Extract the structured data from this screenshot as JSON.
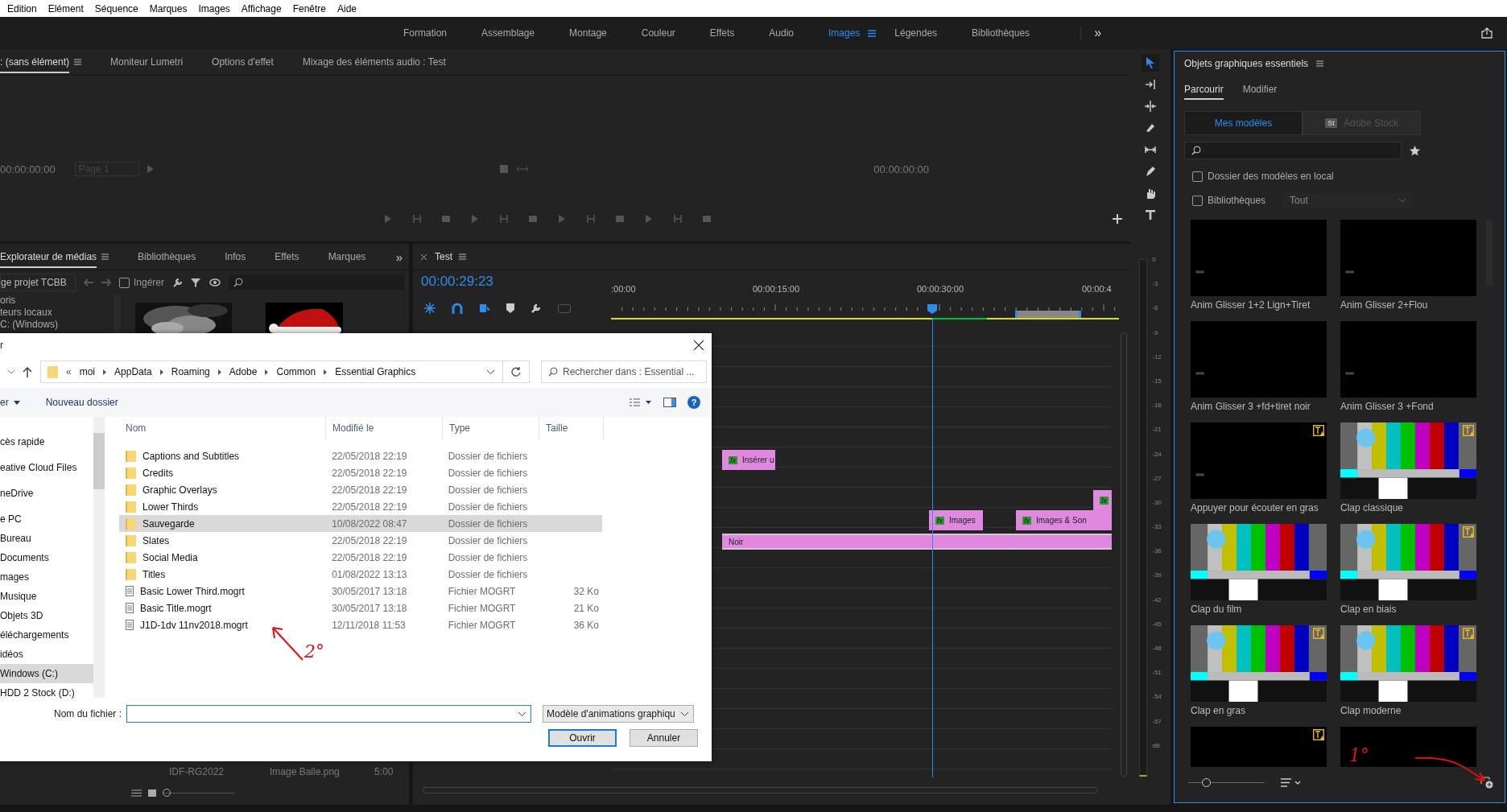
{
  "menu": [
    "Edition",
    "Elément",
    "Séquence",
    "Marques",
    "Images",
    "Affichage",
    "Fenêtre",
    "Aide"
  ],
  "workspaces": [
    {
      "label": "Formation",
      "selected": false
    },
    {
      "label": "Assemblage",
      "selected": false
    },
    {
      "label": "Montage",
      "selected": false
    },
    {
      "label": "Couleur",
      "selected": false
    },
    {
      "label": "Effets",
      "selected": false
    },
    {
      "label": "Audio",
      "selected": false
    },
    {
      "label": "Images",
      "selected": true
    },
    {
      "label": "Légendes",
      "selected": false
    },
    {
      "label": "Bibliothèques",
      "selected": false
    }
  ],
  "workspace_overflow": "»",
  "monitor": {
    "tabs": [
      {
        "label": ": (sans élément)",
        "selected": true
      },
      {
        "label": "Moniteur Lumetri",
        "selected": false
      },
      {
        "label": "Options d'effet",
        "selected": false
      },
      {
        "label": "Mixage des éléments audio : Test",
        "selected": false
      }
    ],
    "timecode_left": "00:00:00:00",
    "page": "Page 1",
    "timecode_right": "00:00:00:00"
  },
  "tools": [
    {
      "selected": true
    },
    {
      "selected": false
    },
    {
      "selected": false
    },
    {
      "selected": false
    },
    {
      "selected": false
    },
    {
      "selected": false
    },
    {
      "selected": false
    },
    {
      "selected": false
    }
  ],
  "media_browser": {
    "tabs": [
      {
        "label": "Explorateur de médias",
        "selected": true
      },
      {
        "label": "Bibliothèques",
        "selected": false
      },
      {
        "label": "Infos",
        "selected": false
      },
      {
        "label": "Effets",
        "selected": false
      },
      {
        "label": "Marques",
        "selected": false
      }
    ],
    "overflow": "»",
    "location": "ge  projet TCBB",
    "ingest": {
      "label": "Ingérer",
      "checked": false
    },
    "tree": [
      "oris",
      "teurs locaux",
      "C: (Windows)"
    ],
    "list_row": [
      "IDF-RG2022",
      "Image Balle.png",
      "5:00"
    ],
    "zoom": {
      "level": 0.0
    }
  },
  "timeline": {
    "tab": "Test",
    "timecode": "00:00:29:23",
    "ruler": [
      ":00:00",
      "00:00:15:00",
      "00:00:30:00",
      "00:00:4"
    ],
    "clips": [
      {
        "label": "Insérer u",
        "badge": "fx"
      },
      {
        "badge": "fx"
      },
      {
        "label": "Images",
        "badge": "fx"
      },
      {
        "label": "Images & Son",
        "badge": "fx"
      },
      {
        "label": "Noir"
      }
    ]
  },
  "audio_meter": {
    "scale": [
      "0",
      "-3",
      "-6",
      "-9",
      "-12",
      "-15",
      "-18",
      "-21",
      "-24",
      "-27",
      "-30",
      "-33",
      "-36",
      "-39",
      "-42",
      "-45",
      "-48",
      "-51",
      "-54",
      "-57"
    ],
    "unit": "dB"
  },
  "essential_graphics": {
    "title": "Objets graphiques essentiels",
    "tabs": [
      {
        "label": "Parcourir",
        "selected": true
      },
      {
        "label": "Modifier",
        "selected": false
      }
    ],
    "sources": [
      {
        "label": "Mes modèles",
        "selected": true
      },
      {
        "label": "Adobe Stock",
        "selected": false,
        "badge": "St"
      }
    ],
    "options": [
      {
        "label": "Dossier des modèles en local",
        "checked": false
      },
      {
        "label": "Bibliothèques",
        "checked": false
      }
    ],
    "library_filter": {
      "value": "Tout",
      "disabled": true
    },
    "thumbnail_size": {
      "level": 0.2
    },
    "templates": [
      {
        "name": "Anim Glisser 1+2 Lign+Tiret",
        "kind": "dark",
        "font_warning": false
      },
      {
        "name": "Anim Glisser 2+Flou",
        "kind": "dark",
        "font_warning": false
      },
      {
        "name": "Anim Glisser 3 +fd+tiret noir",
        "kind": "dark",
        "font_warning": false
      },
      {
        "name": "Anim Glisser 3 +Fond",
        "kind": "dark",
        "font_warning": false
      },
      {
        "name": "Appuyer pour écouter en gras",
        "kind": "dark",
        "font_warning": true
      },
      {
        "name": "Clap classique",
        "kind": "bars",
        "font_warning": true
      },
      {
        "name": "Clap du film",
        "kind": "bars",
        "font_warning": false
      },
      {
        "name": "Clap en biais",
        "kind": "bars",
        "font_warning": true
      },
      {
        "name": "Clap en gras",
        "kind": "bars",
        "font_warning": true
      },
      {
        "name": "Clap moderne",
        "kind": "bars",
        "font_warning": true
      },
      {
        "kind": "dark",
        "font_warning": true
      },
      {
        "kind": "dark",
        "font_warning": false
      }
    ]
  },
  "dialog": {
    "title": "r",
    "path_prefix": "«",
    "path": [
      "moi",
      "AppData",
      "Roaming",
      "Adobe",
      "Common",
      "Essential Graphics"
    ],
    "search_placeholder": "Rechercher dans : Essential ...",
    "organize": "er",
    "new_folder": "Nouveau dossier",
    "help": "?",
    "nav": [
      {
        "label": "cès rapide",
        "selected": false
      },
      {
        "label": "eative Cloud Files",
        "selected": false
      },
      {
        "label": "neDrive",
        "selected": false
      },
      {
        "label": "e PC",
        "selected": false
      },
      {
        "label": "Bureau",
        "selected": false
      },
      {
        "label": "Documents",
        "selected": false
      },
      {
        "label": "mages",
        "selected": false
      },
      {
        "label": "Musique",
        "selected": false
      },
      {
        "label": "Objets 3D",
        "selected": false
      },
      {
        "label": "éléchargements",
        "selected": false
      },
      {
        "label": "idéos",
        "selected": false
      },
      {
        "label": "Windows (C:)",
        "selected": true
      },
      {
        "label": "HDD 2 Stock (D:)",
        "selected": false
      }
    ],
    "columns": [
      "Nom",
      "Modifié le",
      "Type",
      "Taille"
    ],
    "files": [
      {
        "kind": "folder",
        "name": "Captions and Subtitles",
        "modified": "22/05/2018 22:19",
        "type": "Dossier de fichiers",
        "selected": false
      },
      {
        "kind": "folder",
        "name": "Credits",
        "modified": "22/05/2018 22:19",
        "type": "Dossier de fichiers",
        "selected": false
      },
      {
        "kind": "folder",
        "name": "Graphic Overlays",
        "modified": "22/05/2018 22:19",
        "type": "Dossier de fichiers",
        "selected": false
      },
      {
        "kind": "folder",
        "name": "Lower Thirds",
        "modified": "22/05/2018 22:19",
        "type": "Dossier de fichiers",
        "selected": false
      },
      {
        "kind": "folder",
        "name": "Sauvegarde",
        "modified": "10/08/2022 08:47",
        "type": "Dossier de fichiers",
        "selected": true
      },
      {
        "kind": "folder",
        "name": "Slates",
        "modified": "22/05/2018 22:19",
        "type": "Dossier de fichiers",
        "selected": false
      },
      {
        "kind": "folder",
        "name": "Social Media",
        "modified": "22/05/2018 22:19",
        "type": "Dossier de fichiers",
        "selected": false
      },
      {
        "kind": "folder",
        "name": "Titles",
        "modified": "01/08/2022 13:13",
        "type": "Dossier de fichiers",
        "selected": false
      },
      {
        "kind": "file",
        "name": "Basic Lower Third.mogrt",
        "modified": "30/05/2017 13:18",
        "type": "Fichier MOGRT",
        "size": "32 Ko",
        "selected": false
      },
      {
        "kind": "file",
        "name": "Basic Title.mogrt",
        "modified": "30/05/2017 13:18",
        "type": "Fichier MOGRT",
        "size": "21 Ko",
        "selected": false
      },
      {
        "kind": "file",
        "name": "J1D-1dv 11nv2018.mogrt",
        "modified": "12/11/2018 11:53",
        "type": "Fichier MOGRT",
        "size": "36 Ko",
        "selected": false
      }
    ],
    "filename_label": "Nom du fichier :",
    "filter": "Modèle d'animations graphiqu",
    "buttons": [
      "Ouvrir",
      "Annuler"
    ]
  },
  "annotations": [
    {
      "text": "2°"
    },
    {
      "text": "1°"
    }
  ]
}
